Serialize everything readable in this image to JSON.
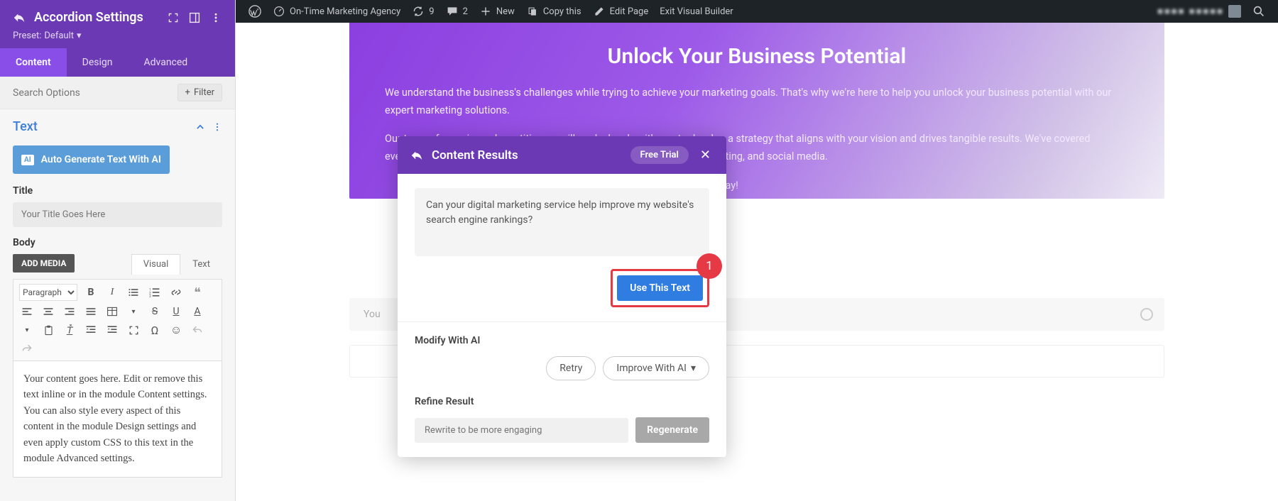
{
  "adminbar": {
    "site_name": "On-Time Marketing Agency",
    "updates": "9",
    "comments": "2",
    "new": "New",
    "copy": "Copy this",
    "edit": "Edit Page",
    "exit": "Exit Visual Builder",
    "user": "■■■■ ■■■■■"
  },
  "sidebar": {
    "title": "Accordion Settings",
    "preset_label": "Preset:",
    "preset_value": "Default",
    "tabs": {
      "content": "Content",
      "design": "Design",
      "advanced": "Advanced"
    },
    "search_placeholder": "Search Options",
    "filter": "Filter",
    "section": "Text",
    "ai_button": "Auto Generate Text With AI",
    "ai_badge": "AI",
    "title_label": "Title",
    "title_placeholder": "Your Title Goes Here",
    "body_label": "Body",
    "add_media": "ADD MEDIA",
    "editor_tabs": {
      "visual": "Visual",
      "text": "Text"
    },
    "paragraph": "Paragraph",
    "body_content": "Your content goes here. Edit or remove this text inline or in the module Content settings. You can also style every aspect of this content in the module Design settings and even apply custom CSS to this text in the module Advanced settings."
  },
  "hero": {
    "title": "Unlock Your Business Potential",
    "p1": "We understand the business's challenges while trying to achieve your marketing goals. That's why we're here to help you unlock your business potential with our expert marketing solutions.",
    "p2": "Our team of experienced practitioners will work closely with you to develop a strategy that aligns with your vision and drives tangible results. We've covered everything from analytics and content strategy to design, SEO, email marketing, and social media.",
    "p3_tail": "h us today!"
  },
  "faq_placeholder": "You",
  "modal": {
    "title": "Content Results",
    "free_trial": "Free Trial",
    "result_text": "Can your digital marketing service help improve my website's search engine rankings?",
    "use_text": "Use This Text",
    "annotation": "1",
    "modify_heading": "Modify With AI",
    "retry": "Retry",
    "improve": "Improve With AI",
    "refine_heading": "Refine Result",
    "refine_placeholder": "Rewrite to be more engaging",
    "regenerate": "Regenerate"
  }
}
